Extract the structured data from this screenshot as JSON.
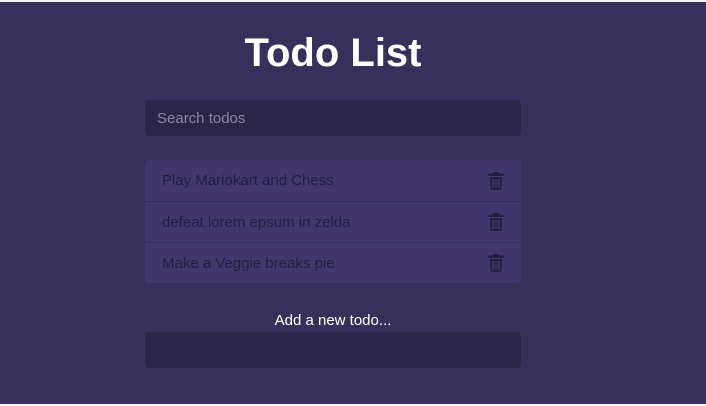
{
  "colors": {
    "page_background": "#36305a",
    "input_background": "#2b2648",
    "list_item_background": "#41376d",
    "text_primary": "#ffffff",
    "todo_text": "#262040",
    "icon_color": "#262040"
  },
  "header": {
    "title": "Todo List"
  },
  "search": {
    "placeholder": "Search todos",
    "value": ""
  },
  "todos": [
    {
      "text": "Play Mariokart and Chess",
      "delete_icon": "trash-icon"
    },
    {
      "text": "defeat lorem epsum in zelda",
      "delete_icon": "trash-icon"
    },
    {
      "text": "Make a Veggie breaks pie",
      "delete_icon": "trash-icon"
    }
  ],
  "add_todo": {
    "label": "Add a new todo...",
    "value": ""
  }
}
